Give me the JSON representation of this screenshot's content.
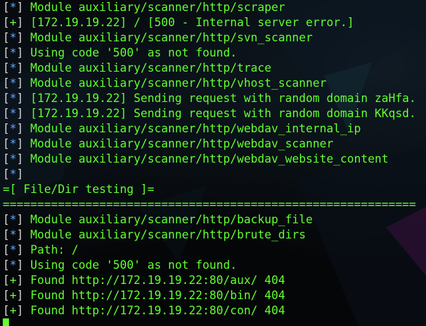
{
  "terminal": {
    "palette": {
      "background": "#050608",
      "text": "#62ff2e",
      "bracket": "#d7d7d7",
      "info_symbol": "#5fa8ff",
      "good_symbol": "#6cff3c"
    },
    "lines": [
      {
        "kind": "info",
        "open": "[",
        "symbol": "*",
        "close": "]",
        "text": " Module auxiliary/scanner/http/scraper"
      },
      {
        "kind": "good",
        "open": "[",
        "symbol": "+",
        "close": "]",
        "text": " [172.19.19.22] / [500 - Internal server error.]"
      },
      {
        "kind": "info",
        "open": "[",
        "symbol": "*",
        "close": "]",
        "text": " Module auxiliary/scanner/http/svn_scanner"
      },
      {
        "kind": "info",
        "open": "[",
        "symbol": "*",
        "close": "]",
        "text": " Using code '500' as not found."
      },
      {
        "kind": "info",
        "open": "[",
        "symbol": "*",
        "close": "]",
        "text": " Module auxiliary/scanner/http/trace"
      },
      {
        "kind": "info",
        "open": "[",
        "symbol": "*",
        "close": "]",
        "text": " Module auxiliary/scanner/http/vhost_scanner"
      },
      {
        "kind": "info",
        "open": "[",
        "symbol": "*",
        "close": "]",
        "text": " [172.19.19.22] Sending request with random domain zaHfa."
      },
      {
        "kind": "info",
        "open": "[",
        "symbol": "*",
        "close": "]",
        "text": " [172.19.19.22] Sending request with random domain KKqsd."
      },
      {
        "kind": "info",
        "open": "[",
        "symbol": "*",
        "close": "]",
        "text": " Module auxiliary/scanner/http/webdav_internal_ip"
      },
      {
        "kind": "info",
        "open": "[",
        "symbol": "*",
        "close": "]",
        "text": " Module auxiliary/scanner/http/webdav_scanner"
      },
      {
        "kind": "info",
        "open": "[",
        "symbol": "*",
        "close": "]",
        "text": " Module auxiliary/scanner/http/webdav_website_content"
      },
      {
        "kind": "info",
        "open": "[",
        "symbol": "*",
        "close": "]",
        "text": ""
      },
      {
        "kind": "plain",
        "text": "=[ File/Dir testing ]="
      },
      {
        "kind": "plain",
        "text": "============================================================"
      },
      {
        "kind": "info",
        "open": "[",
        "symbol": "*",
        "close": "]",
        "text": " Module auxiliary/scanner/http/backup_file"
      },
      {
        "kind": "info",
        "open": "[",
        "symbol": "*",
        "close": "]",
        "text": " Module auxiliary/scanner/http/brute_dirs"
      },
      {
        "kind": "info",
        "open": "[",
        "symbol": "*",
        "close": "]",
        "text": " Path: /"
      },
      {
        "kind": "info",
        "open": "[",
        "symbol": "*",
        "close": "]",
        "text": " Using code '500' as not found."
      },
      {
        "kind": "good",
        "open": "[",
        "symbol": "+",
        "close": "]",
        "text": " Found http://172.19.19.22:80/aux/ 404"
      },
      {
        "kind": "good",
        "open": "[",
        "symbol": "+",
        "close": "]",
        "text": " Found http://172.19.19.22:80/bin/ 404"
      },
      {
        "kind": "good",
        "open": "[",
        "symbol": "+",
        "close": "]",
        "text": " Found http://172.19.19.22:80/con/ 404"
      }
    ]
  }
}
